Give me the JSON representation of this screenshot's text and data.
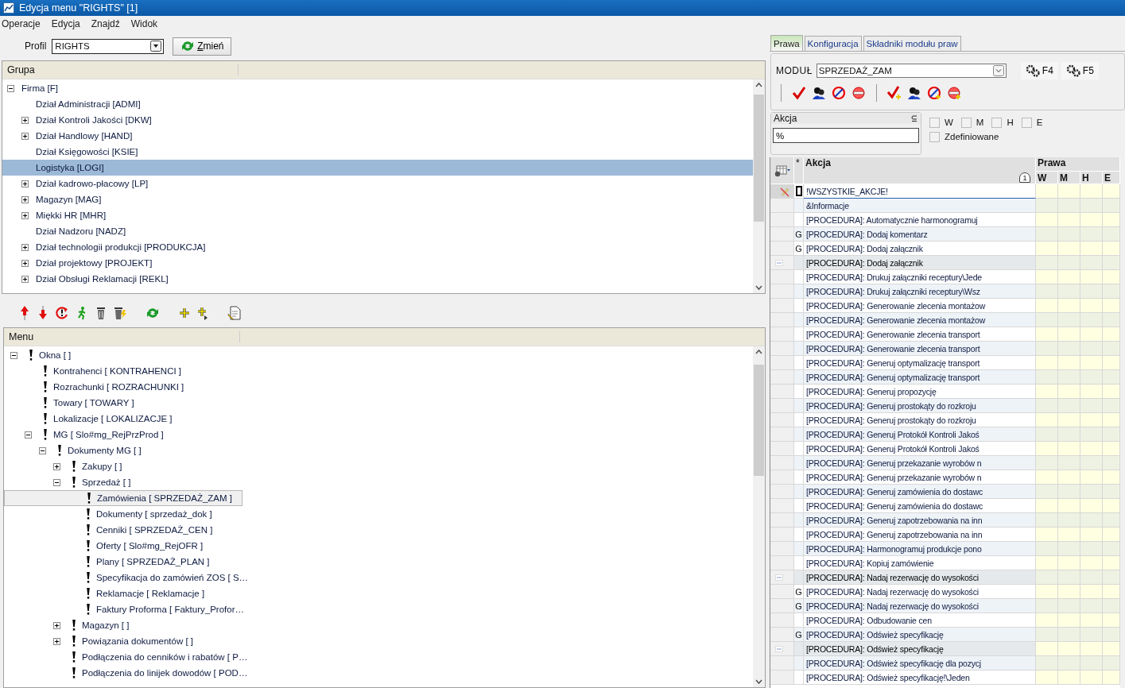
{
  "window": {
    "title": "Edycja menu \"RIGHTS\" [1]"
  },
  "menubar": [
    "Operacje",
    "Edycja",
    "Znajdź",
    "Widok"
  ],
  "profile": {
    "label": "Profil",
    "value": "RIGHTS",
    "button": "Zmień"
  },
  "group_tree": {
    "header": "Grupa",
    "items": [
      {
        "label": "Firma [F]",
        "expanded": true,
        "selected": false,
        "children": [
          {
            "label": "Dział Administracji [ADMI]",
            "selected": false
          },
          {
            "label": "Dział Kontroli Jakości [DKW]",
            "expanded": false,
            "selected": false
          },
          {
            "label": "Dział Handlowy [HAND]",
            "expanded": false,
            "selected": false
          },
          {
            "label": "Dział Księgowości [KSIE]",
            "selected": false
          },
          {
            "label": "Logistyka [LOGI]",
            "selected": true
          },
          {
            "label": "Dział kadrowo-płacowy [LP]",
            "expanded": false,
            "selected": false
          },
          {
            "label": "Magazyn [MAG]",
            "expanded": false,
            "selected": false
          },
          {
            "label": "Miękki HR [MHR]",
            "expanded": false,
            "selected": false
          },
          {
            "label": "Dział Nadzoru [NADZ]",
            "selected": false
          },
          {
            "label": "Dział technologii produkcji [PRODUKCJA]",
            "expanded": false,
            "selected": false
          },
          {
            "label": "Dział projektowy [PROJEKT]",
            "expanded": false,
            "selected": false
          },
          {
            "label": "Dział Obsługi Reklamacji [REKL]",
            "expanded": false,
            "selected": false
          }
        ]
      }
    ]
  },
  "menu_tree": {
    "header": "Menu",
    "items": [
      {
        "label": "Okna [ ]",
        "expanded": true,
        "selected": false,
        "children": [
          {
            "label": "Kontrahenci [ KONTRAHENCI ]",
            "selected": false
          },
          {
            "label": "Rozrachunki [ ROZRACHUNKI ]",
            "selected": false
          },
          {
            "label": "Towary [ TOWARY ]",
            "selected": false
          },
          {
            "label": "Lokalizacje [ LOKALIZACJE ]",
            "selected": false
          },
          {
            "label": "MG [ Slo#mg_RejPrzProd ]",
            "expanded": true,
            "selected": false,
            "children": [
              {
                "label": "Dokumenty MG [ ]",
                "expanded": true,
                "selected": false,
                "children": [
                  {
                    "label": "Zakupy [ ]",
                    "expanded": false,
                    "selected": false
                  },
                  {
                    "label": "Sprzedaż [ ]",
                    "expanded": true,
                    "selected": false,
                    "children": [
                      {
                        "label": "Zamówienia [ SPRZEDAŻ_ZAM ]",
                        "selected": true
                      },
                      {
                        "label": "Dokumenty [ sprzedaż_dok ]",
                        "selected": false
                      },
                      {
                        "label": "Cenniki [ SPRZEDAŻ_CEN ]",
                        "selected": false
                      },
                      {
                        "label": "Oferty [ Slo#mg_RejOFR ]",
                        "selected": false
                      },
                      {
                        "label": "Plany [ SPRZEDAŻ_PLAN ]",
                        "selected": false
                      },
                      {
                        "label": "Specyfikacja do zamówień ZOS [ S…",
                        "selected": false
                      },
                      {
                        "label": "Reklamacje [ Reklamacje ]",
                        "selected": false
                      },
                      {
                        "label": "Faktury Proforma [ Faktury_Profor…",
                        "selected": false
                      }
                    ]
                  },
                  {
                    "label": "Magazyn [ ]",
                    "expanded": false,
                    "selected": false
                  },
                  {
                    "label": "Powiązania dokumentów [ ]",
                    "expanded": false,
                    "selected": false
                  },
                  {
                    "label": "Podłączenia do cenników i rabatów [ P…",
                    "selected": false
                  },
                  {
                    "label": "Podłączenia do linijek dowodów [ POD…",
                    "selected": false
                  }
                ]
              }
            ]
          }
        ]
      }
    ]
  },
  "tabs": [
    {
      "label": "Prawa",
      "selected": true
    },
    {
      "label": "Konfiguracja",
      "selected": false
    },
    {
      "label": "Składniki modułu praw",
      "selected": false
    }
  ],
  "module": {
    "label": "MODUŁ",
    "value": "SPRZEDAŻ_ZAM",
    "buttons": [
      "F4",
      "F5"
    ]
  },
  "filter": {
    "label": "Akcja",
    "value": "%",
    "checks": [
      {
        "label": "W",
        "checked": false
      },
      {
        "label": "M",
        "checked": false
      },
      {
        "label": "H",
        "checked": false
      },
      {
        "label": "E",
        "checked": false
      },
      {
        "label": "Zdefiniowane",
        "checked": false
      }
    ]
  },
  "grid": {
    "star": "*",
    "action_header": "Akcja",
    "sort_badge": "1",
    "rights_header": "Prawa",
    "rights_columns": [
      "W",
      "M",
      "H",
      "E"
    ],
    "rows": [
      {
        "kind": "edit",
        "text": "!WSZYSTKIE_AKCJE!"
      },
      {
        "kind": "plain",
        "text": "&Informacje"
      },
      {
        "kind": "plain",
        "text": "[PROCEDURA]: Automatycznie harmonogramuj"
      },
      {
        "kind": "plain",
        "flag": "G",
        "text": "[PROCEDURA]: Dodaj komentarz"
      },
      {
        "kind": "plain",
        "flag": "G",
        "text": "[PROCEDURA]: Dodaj załącznik"
      },
      {
        "kind": "more",
        "text": "[PROCEDURA]: Dodaj załącznik"
      },
      {
        "kind": "plain",
        "text": "[PROCEDURA]: Drukuj załączniki receptury\\Jede"
      },
      {
        "kind": "plain",
        "text": "[PROCEDURA]: Drukuj załączniki receptury\\Wsz"
      },
      {
        "kind": "plain",
        "text": "[PROCEDURA]: Generowanie zlecenia montażow"
      },
      {
        "kind": "plain",
        "text": "[PROCEDURA]: Generowanie zlecenia montażow"
      },
      {
        "kind": "plain",
        "text": "[PROCEDURA]: Generowanie zlecenia transport"
      },
      {
        "kind": "plain",
        "text": "[PROCEDURA]: Generowanie zlecenia transport"
      },
      {
        "kind": "plain",
        "text": "[PROCEDURA]: Generuj optymalizację transport"
      },
      {
        "kind": "plain",
        "text": "[PROCEDURA]: Generuj optymalizację transport"
      },
      {
        "kind": "plain",
        "text": "[PROCEDURA]: Generuj propozycję"
      },
      {
        "kind": "plain",
        "text": "[PROCEDURA]: Generuj prostokąty do rozkroju"
      },
      {
        "kind": "plain",
        "text": "[PROCEDURA]: Generuj prostokąty do rozkroju"
      },
      {
        "kind": "plain",
        "text": "[PROCEDURA]: Generuj Protokół Kontroli Jakoś"
      },
      {
        "kind": "plain",
        "text": "[PROCEDURA]: Generuj Protokół Kontroli Jakoś"
      },
      {
        "kind": "plain",
        "text": "[PROCEDURA]: Generuj przekazanie wyrobów n"
      },
      {
        "kind": "plain",
        "text": "[PROCEDURA]: Generuj przekazanie wyrobów n"
      },
      {
        "kind": "plain",
        "text": "[PROCEDURA]: Generuj zamówienia do dostawc"
      },
      {
        "kind": "plain",
        "text": "[PROCEDURA]: Generuj zamówienia do dostawc"
      },
      {
        "kind": "plain",
        "text": "[PROCEDURA]: Generuj zapotrzebowania na inn"
      },
      {
        "kind": "plain",
        "text": "[PROCEDURA]: Generuj zapotrzebowania na inn"
      },
      {
        "kind": "plain",
        "text": "[PROCEDURA]: Harmonogramuj produkcje pono"
      },
      {
        "kind": "plain",
        "text": "[PROCEDURA]: Kopiuj zamówienie"
      },
      {
        "kind": "more",
        "text": "[PROCEDURA]: Nadaj rezerwację do wysokości"
      },
      {
        "kind": "plain",
        "flag": "G",
        "text": "[PROCEDURA]: Nadaj rezerwację do wysokości"
      },
      {
        "kind": "plain",
        "flag": "G",
        "text": "[PROCEDURA]: Nadaj rezerwację do wysokości"
      },
      {
        "kind": "plain",
        "text": "[PROCEDURA]: Odbudowanie cen"
      },
      {
        "kind": "plain",
        "flag": "G",
        "text": "[PROCEDURA]: Odśwież specyfikację"
      },
      {
        "kind": "more",
        "text": "[PROCEDURA]: Odśwież specyfikację"
      },
      {
        "kind": "plain",
        "text": "[PROCEDURA]: Odśwież specyfikację dla pozycj"
      },
      {
        "kind": "plain",
        "text": "[PROCEDURA]: Odśwież specyfikację!\\Jeden"
      }
    ]
  }
}
